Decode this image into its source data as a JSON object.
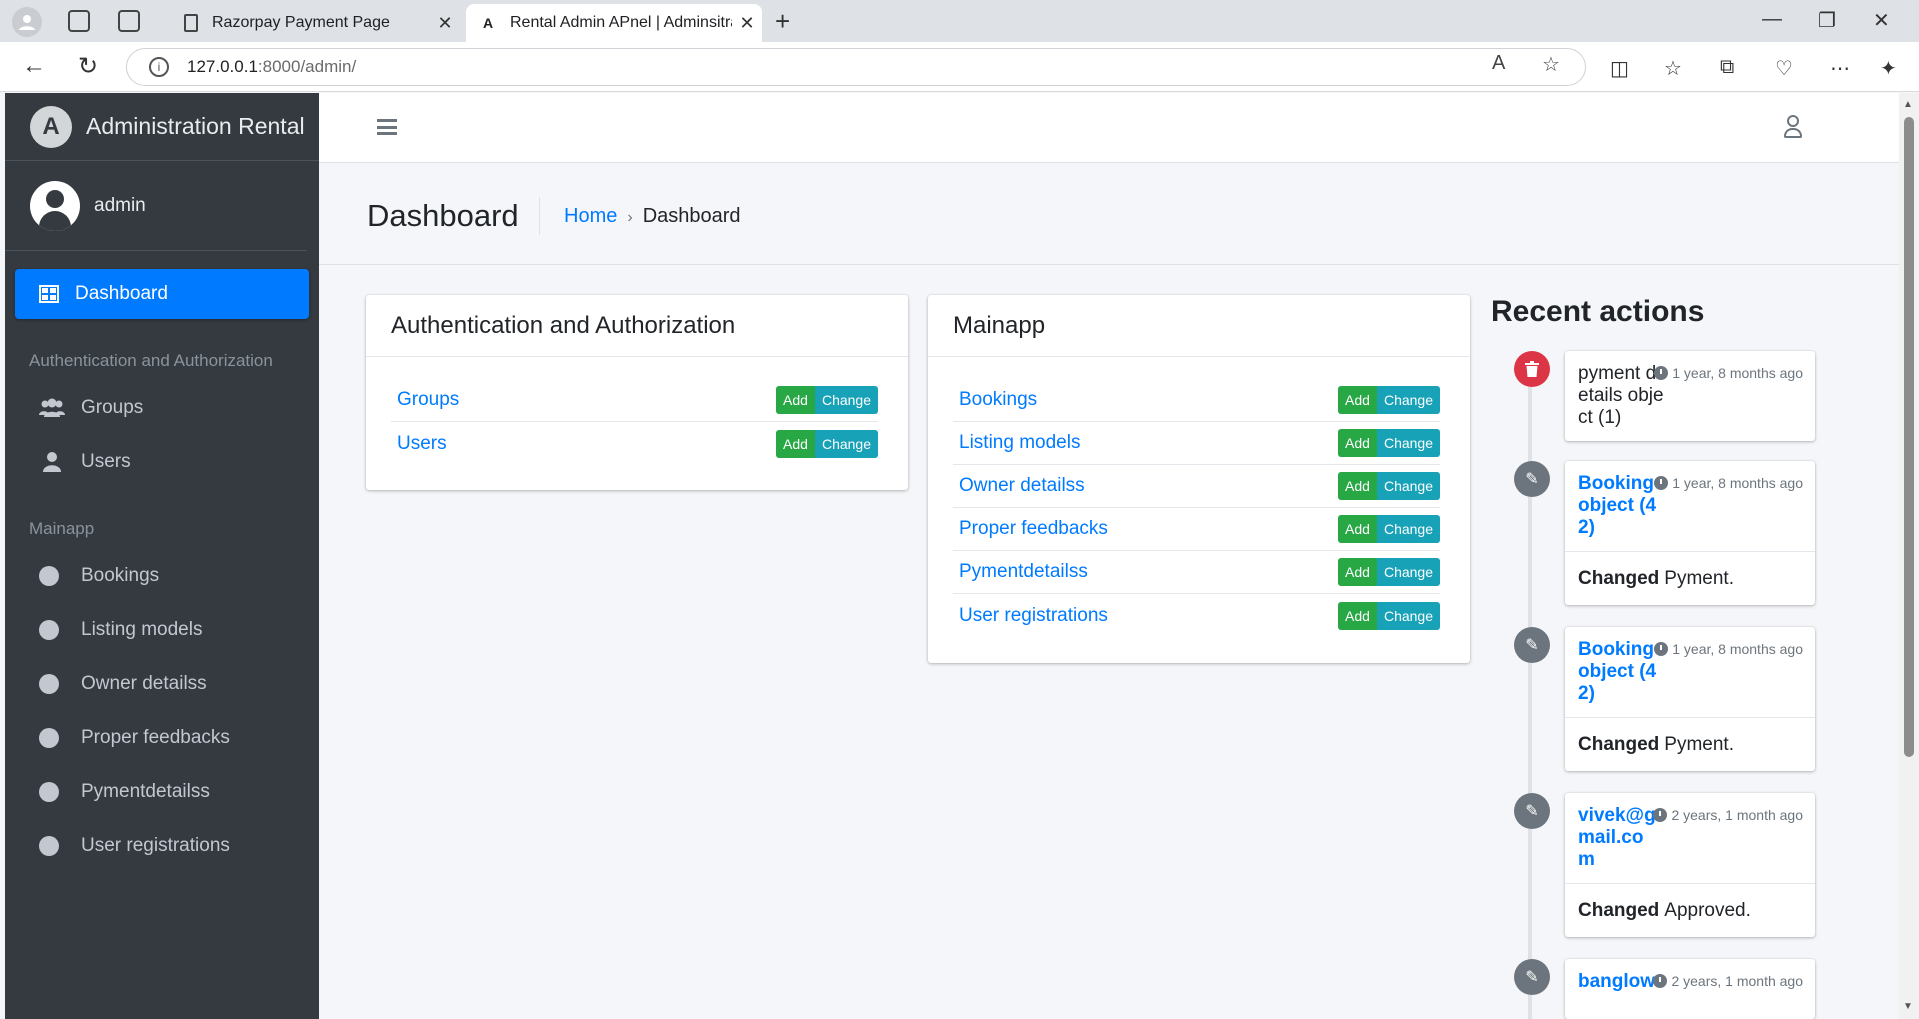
{
  "browser": {
    "tabs": [
      {
        "title": "Razorpay Payment Page",
        "active": false
      },
      {
        "title": "Rental Admin APnel | Adminsitrati",
        "active": true
      }
    ],
    "url_host": "127.0.0.1",
    "url_path": ":8000/admin/"
  },
  "sidebar": {
    "brand": "Administration Rental",
    "user": "admin",
    "active_item": "Dashboard",
    "groups": [
      {
        "header": "Authentication and Authorization",
        "items": [
          "Groups",
          "Users"
        ]
      },
      {
        "header": "Mainapp",
        "items": [
          "Bookings",
          "Listing models",
          "Owner detailss",
          "Proper feedbacks",
          "Pymentdetailss",
          "User registrations"
        ]
      }
    ]
  },
  "header": {
    "title": "Dashboard",
    "breadcrumb_home": "Home",
    "breadcrumb_sep": "›",
    "breadcrumb_current": "Dashboard"
  },
  "apps": [
    {
      "name": "Authentication and Authorization",
      "models": [
        "Groups",
        "Users"
      ]
    },
    {
      "name": "Mainapp",
      "models": [
        "Bookings",
        "Listing models",
        "Owner detailss",
        "Proper feedbacks",
        "Pymentdetailss",
        "User registrations"
      ]
    }
  ],
  "buttons": {
    "add": "Add",
    "change": "Change"
  },
  "recent": {
    "title": "Recent actions",
    "items": [
      {
        "type": "delete",
        "name": "pyment details object (1)",
        "time": "1 year, 8 months ago",
        "action": "",
        "detail": ""
      },
      {
        "type": "edit",
        "name": "Booking object (42)",
        "time": "1 year, 8 months ago",
        "action": "Changed",
        "detail": "Pyment."
      },
      {
        "type": "edit",
        "name": "Booking object (42)",
        "time": "1 year, 8 months ago",
        "action": "Changed",
        "detail": "Pyment."
      },
      {
        "type": "edit",
        "name": "vivek@gmail.com",
        "time": "2 years, 1 month ago",
        "action": "Changed",
        "detail": "Approved."
      },
      {
        "type": "edit",
        "name": "banglow",
        "time": "2 years, 1 month ago",
        "action": "",
        "detail": ""
      }
    ]
  },
  "colors": {
    "sidebar_bg": "#343a40",
    "primary": "#007bff",
    "add_btn": "#28a745",
    "change_btn": "#17a2b8",
    "delete_icon": "#dc3545"
  }
}
